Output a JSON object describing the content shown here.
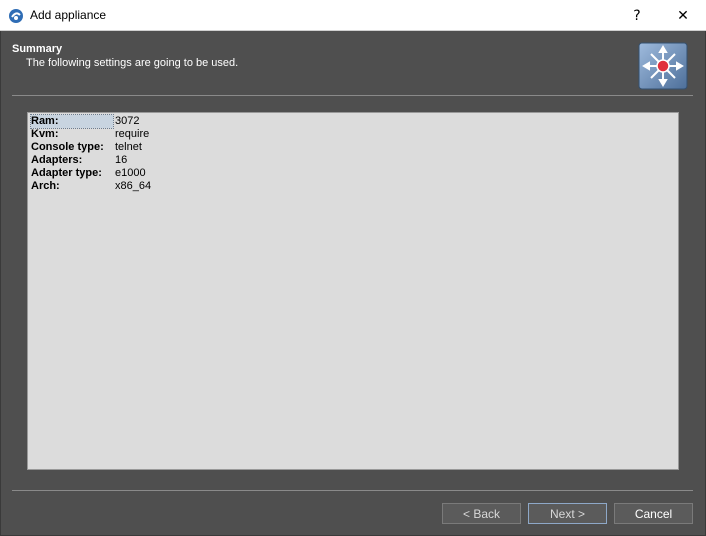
{
  "window": {
    "title": "Add appliance",
    "help_glyph": "?",
    "close_glyph": "✕"
  },
  "header": {
    "title": "Summary",
    "subtitle": "The following settings are going to be used.",
    "logo_icon": "switch-router-icon"
  },
  "summary": {
    "rows": [
      {
        "key": "Ram:",
        "value": "3072"
      },
      {
        "key": "Kvm:",
        "value": "require"
      },
      {
        "key": "Console type:",
        "value": "telnet"
      },
      {
        "key": "Adapters:",
        "value": "16"
      },
      {
        "key": "Adapter type:",
        "value": "e1000"
      },
      {
        "key": "Arch:",
        "value": "x86_64"
      }
    ]
  },
  "buttons": {
    "back": "< Back",
    "next": "Next >",
    "cancel": "Cancel"
  },
  "colors": {
    "background": "#4f4f4f",
    "panel": "#dcdcdc",
    "logo_bg": "#6d8fb8",
    "logo_accent": "#e0303c"
  }
}
